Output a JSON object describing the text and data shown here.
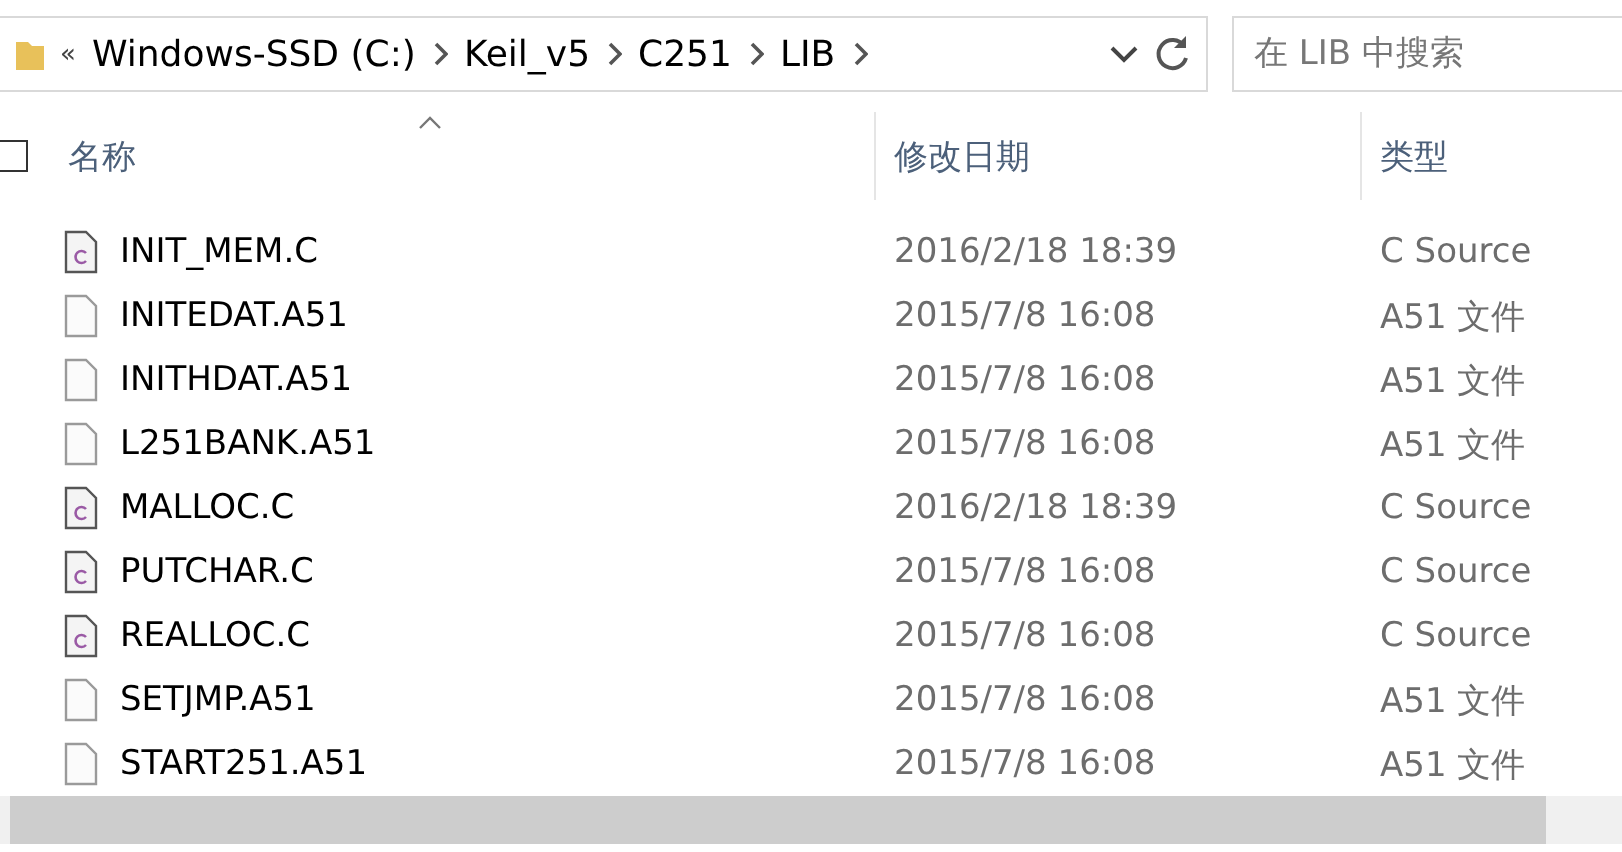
{
  "address_bar": {
    "overflow": "«",
    "crumbs": [
      "Windows-SSD (C:)",
      "Keil_v5",
      "C251",
      "LIB"
    ]
  },
  "search": {
    "placeholder": "在 LIB 中搜索"
  },
  "select_all": {
    "checked": false
  },
  "columns": [
    "名称",
    "修改日期",
    "类型"
  ],
  "rows": [
    {
      "kind": "c",
      "name": "INIT_MEM.C",
      "date": "2016/2/18 18:39",
      "type": "C Source"
    },
    {
      "kind": "plain",
      "name": "INITEDAT.A51",
      "date": "2015/7/8 16:08",
      "type": "A51 文件"
    },
    {
      "kind": "plain",
      "name": "INITHDAT.A51",
      "date": "2015/7/8 16:08",
      "type": "A51 文件"
    },
    {
      "kind": "plain",
      "name": "L251BANK.A51",
      "date": "2015/7/8 16:08",
      "type": "A51 文件"
    },
    {
      "kind": "c",
      "name": "MALLOC.C",
      "date": "2016/2/18 18:39",
      "type": "C Source"
    },
    {
      "kind": "c",
      "name": "PUTCHAR.C",
      "date": "2015/7/8 16:08",
      "type": "C Source"
    },
    {
      "kind": "c",
      "name": "REALLOC.C",
      "date": "2015/7/8 16:08",
      "type": "C Source"
    },
    {
      "kind": "plain",
      "name": "SETJMP.A51",
      "date": "2015/7/8 16:08",
      "type": "A51 文件"
    },
    {
      "kind": "plain",
      "name": "START251.A51",
      "date": "2015/7/8 16:08",
      "type": "A51 文件"
    }
  ]
}
